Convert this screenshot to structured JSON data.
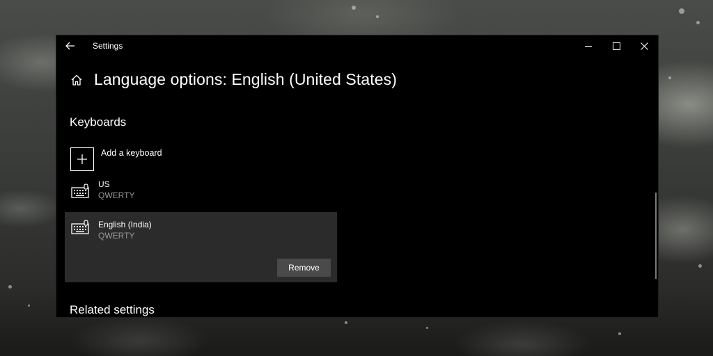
{
  "window": {
    "title": "Settings"
  },
  "header": {
    "title": "Language options: English (United States)"
  },
  "keyboards": {
    "heading": "Keyboards",
    "add_label": "Add a keyboard",
    "items": [
      {
        "name": "US",
        "layout": "QWERTY"
      },
      {
        "name": "English (India)",
        "layout": "QWERTY",
        "action": "Remove"
      }
    ]
  },
  "related": {
    "heading": "Related settings"
  },
  "icons": {
    "back": "back-arrow-icon",
    "home": "home-icon",
    "add": "plus-icon",
    "keyboard": "keyboard-icon",
    "minimize": "minimize-icon",
    "maximize": "maximize-icon",
    "close": "close-icon"
  },
  "colors": {
    "window_bg": "#000000",
    "selected_bg": "#2b2b2b",
    "button_bg": "#4a4a4a",
    "secondary_text": "#999999"
  }
}
